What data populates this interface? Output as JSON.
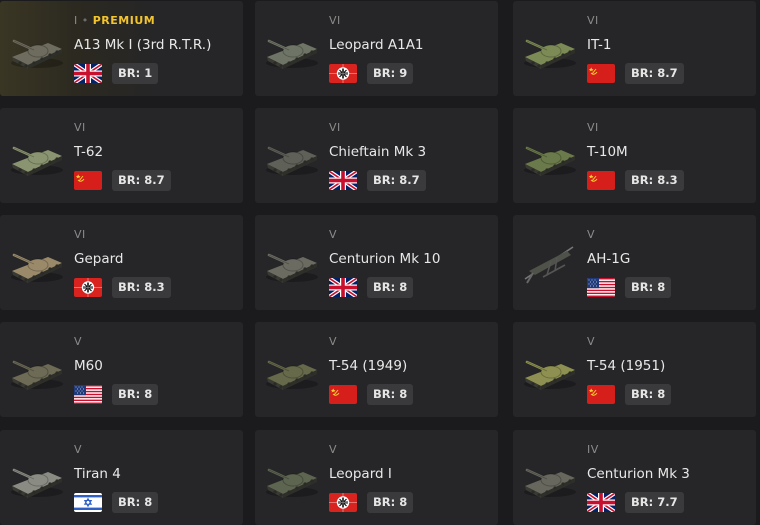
{
  "vehicles": [
    {
      "tier": "I",
      "premium_label": "PREMIUM",
      "name": "A13 Mk I (3rd R.T.R.)",
      "nation": "uk",
      "br": "BR: 1",
      "tank_color": "#6e6c5e"
    },
    {
      "tier": "VI",
      "name": "Leopard A1A1",
      "nation": "germany",
      "br": "BR: 9",
      "tank_color": "#6f7566"
    },
    {
      "tier": "VI",
      "name": "IT-1",
      "nation": "ussr",
      "br": "BR: 8.7",
      "tank_color": "#7c8a55"
    },
    {
      "tier": "VI",
      "name": "T-62",
      "nation": "ussr",
      "br": "BR: 8.7",
      "tank_color": "#8a9470"
    },
    {
      "tier": "VI",
      "name": "Chieftain Mk 3",
      "nation": "uk",
      "br": "BR: 8.7",
      "tank_color": "#5f6058"
    },
    {
      "tier": "VI",
      "name": "T-10M",
      "nation": "ussr",
      "br": "BR: 8.3",
      "tank_color": "#6b7a4a"
    },
    {
      "tier": "VI",
      "name": "Gepard",
      "nation": "germany",
      "br": "BR: 8.3",
      "tank_color": "#9a8a6a"
    },
    {
      "tier": "V",
      "name": "Centurion Mk 10",
      "nation": "uk",
      "br": "BR: 8",
      "tank_color": "#6c6b62"
    },
    {
      "tier": "V",
      "name": "AH-1G",
      "nation": "usa",
      "br": "BR: 8",
      "tank_color": "#4e5248"
    },
    {
      "tier": "V",
      "name": "M60",
      "nation": "usa",
      "br": "BR: 8",
      "tank_color": "#6d6a55"
    },
    {
      "tier": "V",
      "name": "T-54 (1949)",
      "nation": "ussr",
      "br": "BR: 8",
      "tank_color": "#66694a"
    },
    {
      "tier": "V",
      "name": "T-54 (1951)",
      "nation": "ussr",
      "br": "BR: 8",
      "tank_color": "#8d9050"
    },
    {
      "tier": "V",
      "name": "Tiran 4",
      "nation": "israel",
      "br": "BR: 8",
      "tank_color": "#8a8c84"
    },
    {
      "tier": "V",
      "name": "Leopard I",
      "nation": "germany",
      "br": "BR: 8",
      "tank_color": "#5d6450"
    },
    {
      "tier": "IV",
      "name": "Centurion Mk 3",
      "nation": "uk",
      "br": "BR: 7.7",
      "tank_color": "#67675e"
    }
  ]
}
